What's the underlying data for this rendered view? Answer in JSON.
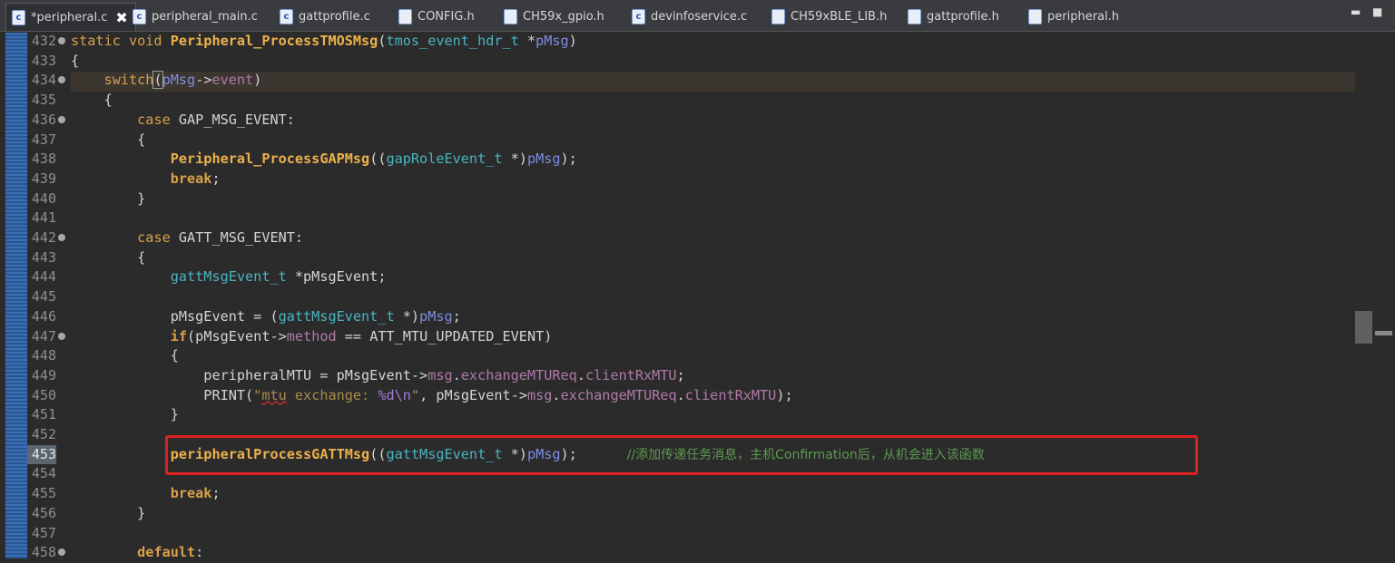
{
  "tabs": [
    {
      "label": "*peripheral.c",
      "active": true
    },
    {
      "label": "peripheral_main.c"
    },
    {
      "label": "gattprofile.c"
    },
    {
      "label": "CONFIG.h"
    },
    {
      "label": "CH59x_gpio.h"
    },
    {
      "label": "devinfoservice.c"
    },
    {
      "label": "CH59xBLE_LIB.h"
    },
    {
      "label": "gattprofile.h"
    },
    {
      "label": "peripheral.h"
    }
  ],
  "window_controls": {
    "minimize": "▬",
    "maximize": "■"
  },
  "close_glyph": "✖",
  "file_icon_glyph": "c",
  "line_numbers": [
    "432",
    "433",
    "434",
    "435",
    "436",
    "437",
    "438",
    "439",
    "440",
    "441",
    "442",
    "443",
    "444",
    "445",
    "446",
    "447",
    "448",
    "449",
    "450",
    "451",
    "452",
    "453",
    "454",
    "455",
    "456",
    "457",
    "458"
  ],
  "code": {
    "l432": {
      "a": "static void ",
      "b": "Peripheral_ProcessTMOSMsg",
      "c": "(",
      "d": "tmos_event_hdr_t",
      "e": " *",
      "f": "pMsg",
      "g": ")"
    },
    "l433": {
      "a": "{"
    },
    "l434": {
      "a": "    ",
      "b": "switch",
      "c": "(",
      "d": "pMsg",
      "e": "->",
      "f": "event",
      "g": ")"
    },
    "l435": {
      "a": "    {"
    },
    "l436": {
      "a": "        ",
      "b": "case",
      " c": " GAP_MSG_EVENT:"
    },
    "l437": {
      "a": "        {"
    },
    "l438": {
      "a": "            ",
      "b": "Peripheral_ProcessGAPMsg",
      "c": "((",
      "d": "gapRoleEvent_t",
      "e": " *)",
      "f": "pMsg",
      "g": ");"
    },
    "l439": {
      "a": "            ",
      "b": "break",
      ";": ";"
    },
    "l440": {
      "a": "        }"
    },
    "l442": {
      "a": "        ",
      "b": "case",
      "c": " GATT_MSG_EVENT:"
    },
    "l443": {
      "a": "        {"
    },
    "l444": {
      "a": "            ",
      "b": "gattMsgEvent_t",
      "c": " *pMsgEvent;"
    },
    "l446": {
      "a": "            pMsgEvent = (",
      "b": "gattMsgEvent_t",
      "c": " *)",
      "d": "pMsg",
      ";": ";"
    },
    "l447": {
      "a": "            ",
      "b": "if",
      "c": "(pMsgEvent->",
      "d": "method",
      "e": " == ATT_MTU_UPDATED_EVENT)"
    },
    "l448": {
      "a": "            {"
    },
    "l449": {
      "a": "                peripheralMTU = pMsgEvent->",
      "b": "msg",
      ".": ".",
      "c": "exchangeMTUReq",
      "d": "clientRxMTU",
      ";": ";"
    },
    "l450": {
      "a": "                PRINT(",
      "q1": "\"",
      "b": "mtu",
      ".": " exchange: ",
      "f": "%d",
      "n": "\\n",
      "q2": "\"",
      "c": ", pMsgEvent->",
      "d": "msg",
      "e": "exchangeMTUReq",
      "g": "clientRxMTU",
      "h": ");"
    },
    "l451": {
      "a": "            }"
    },
    "l453": {
      "a": "            ",
      "b": "peripheralProcessGATTMsg",
      "c": "((",
      "d": "gattMsgEvent_t",
      "e": " *)",
      "f": "pMsg",
      "g": ");",
      "cm": "//添加传递任务消息，主机Confirmation后，从机会进入该函数"
    },
    "l455": {
      "a": "            ",
      "b": "break",
      ";": ";"
    },
    "l456": {
      "a": "        }"
    },
    "l458": {
      "a": "        ",
      "b": "default",
      ":": ":"
    }
  }
}
